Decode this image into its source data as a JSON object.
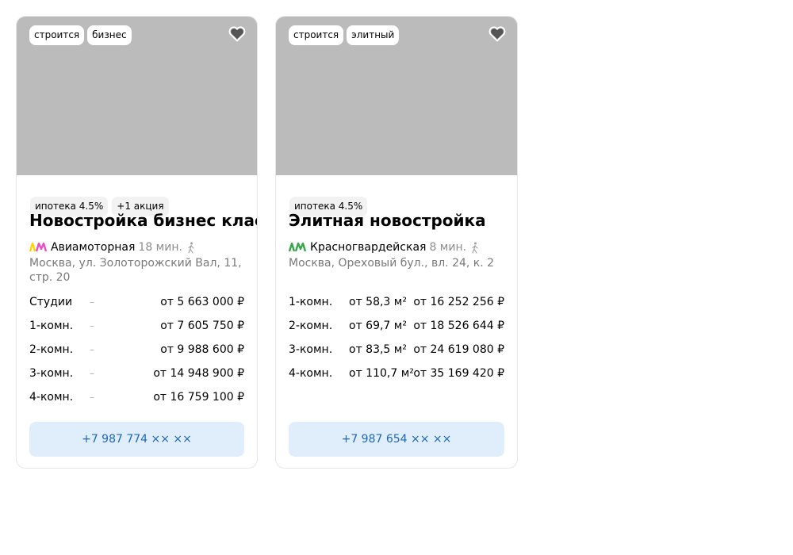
{
  "colors": {
    "photo_placeholder": "#bbbbbb",
    "phone_button_bg": "#e0eefc",
    "phone_button_text": "#1f66b8",
    "metro_line_1": "#ffd400",
    "metro_line_2": "#e74fc7",
    "metro_line_green": "#3aa64b"
  },
  "cards": [
    {
      "status_tags": [
        "строится",
        "бизнес"
      ],
      "favorite_icon": "heart-icon",
      "promo_tags": [
        "ипотека 4.5%",
        "+1 акция"
      ],
      "title": "Новостройка бизнес класса",
      "metro": {
        "icon": "metro-icon",
        "station": "Авиамоторная",
        "time": "18 мин.",
        "walk_icon": "walking-person-icon"
      },
      "address": "Москва, ул. Золоторожский Вал, 11, стр. 20",
      "rows": [
        {
          "type": "Студии",
          "area": "–",
          "price": "от 5 663 000 ₽"
        },
        {
          "type": "1-комн.",
          "area": "–",
          "price": "от 7 605 750 ₽"
        },
        {
          "type": "2-комн.",
          "area": "–",
          "price": "от 9 988 600 ₽"
        },
        {
          "type": "3-комн.",
          "area": "–",
          "price": "от 14 948 900 ₽"
        },
        {
          "type": "4-комн.",
          "area": "–",
          "price": "от 16 759 100 ₽"
        }
      ],
      "phone": "+7 987 774 ×× ××"
    },
    {
      "status_tags": [
        "строится",
        "элитный"
      ],
      "favorite_icon": "heart-icon",
      "promo_tags": [
        "ипотека 4.5%"
      ],
      "title": "Элитная новостройка",
      "metro": {
        "icon": "metro-icon",
        "station": "Красногвардейская",
        "time": "8 мин.",
        "walk_icon": "walking-person-icon"
      },
      "address": "Москва, Ореховый бул., вл. 24, к. 2",
      "rows": [
        {
          "type": "1-комн.",
          "area": "от 58,3 м²",
          "price": "от 16 252 256 ₽"
        },
        {
          "type": "2-комн.",
          "area": "от 69,7 м²",
          "price": "от 18 526 644 ₽"
        },
        {
          "type": "3-комн.",
          "area": "от 83,5 м²",
          "price": "от 24 619 080 ₽"
        },
        {
          "type": "4-комн.",
          "area": "от 110,7 м²",
          "price": "от 35 169 420 ₽"
        }
      ],
      "phone": "+7 987 654 ×× ××"
    }
  ]
}
